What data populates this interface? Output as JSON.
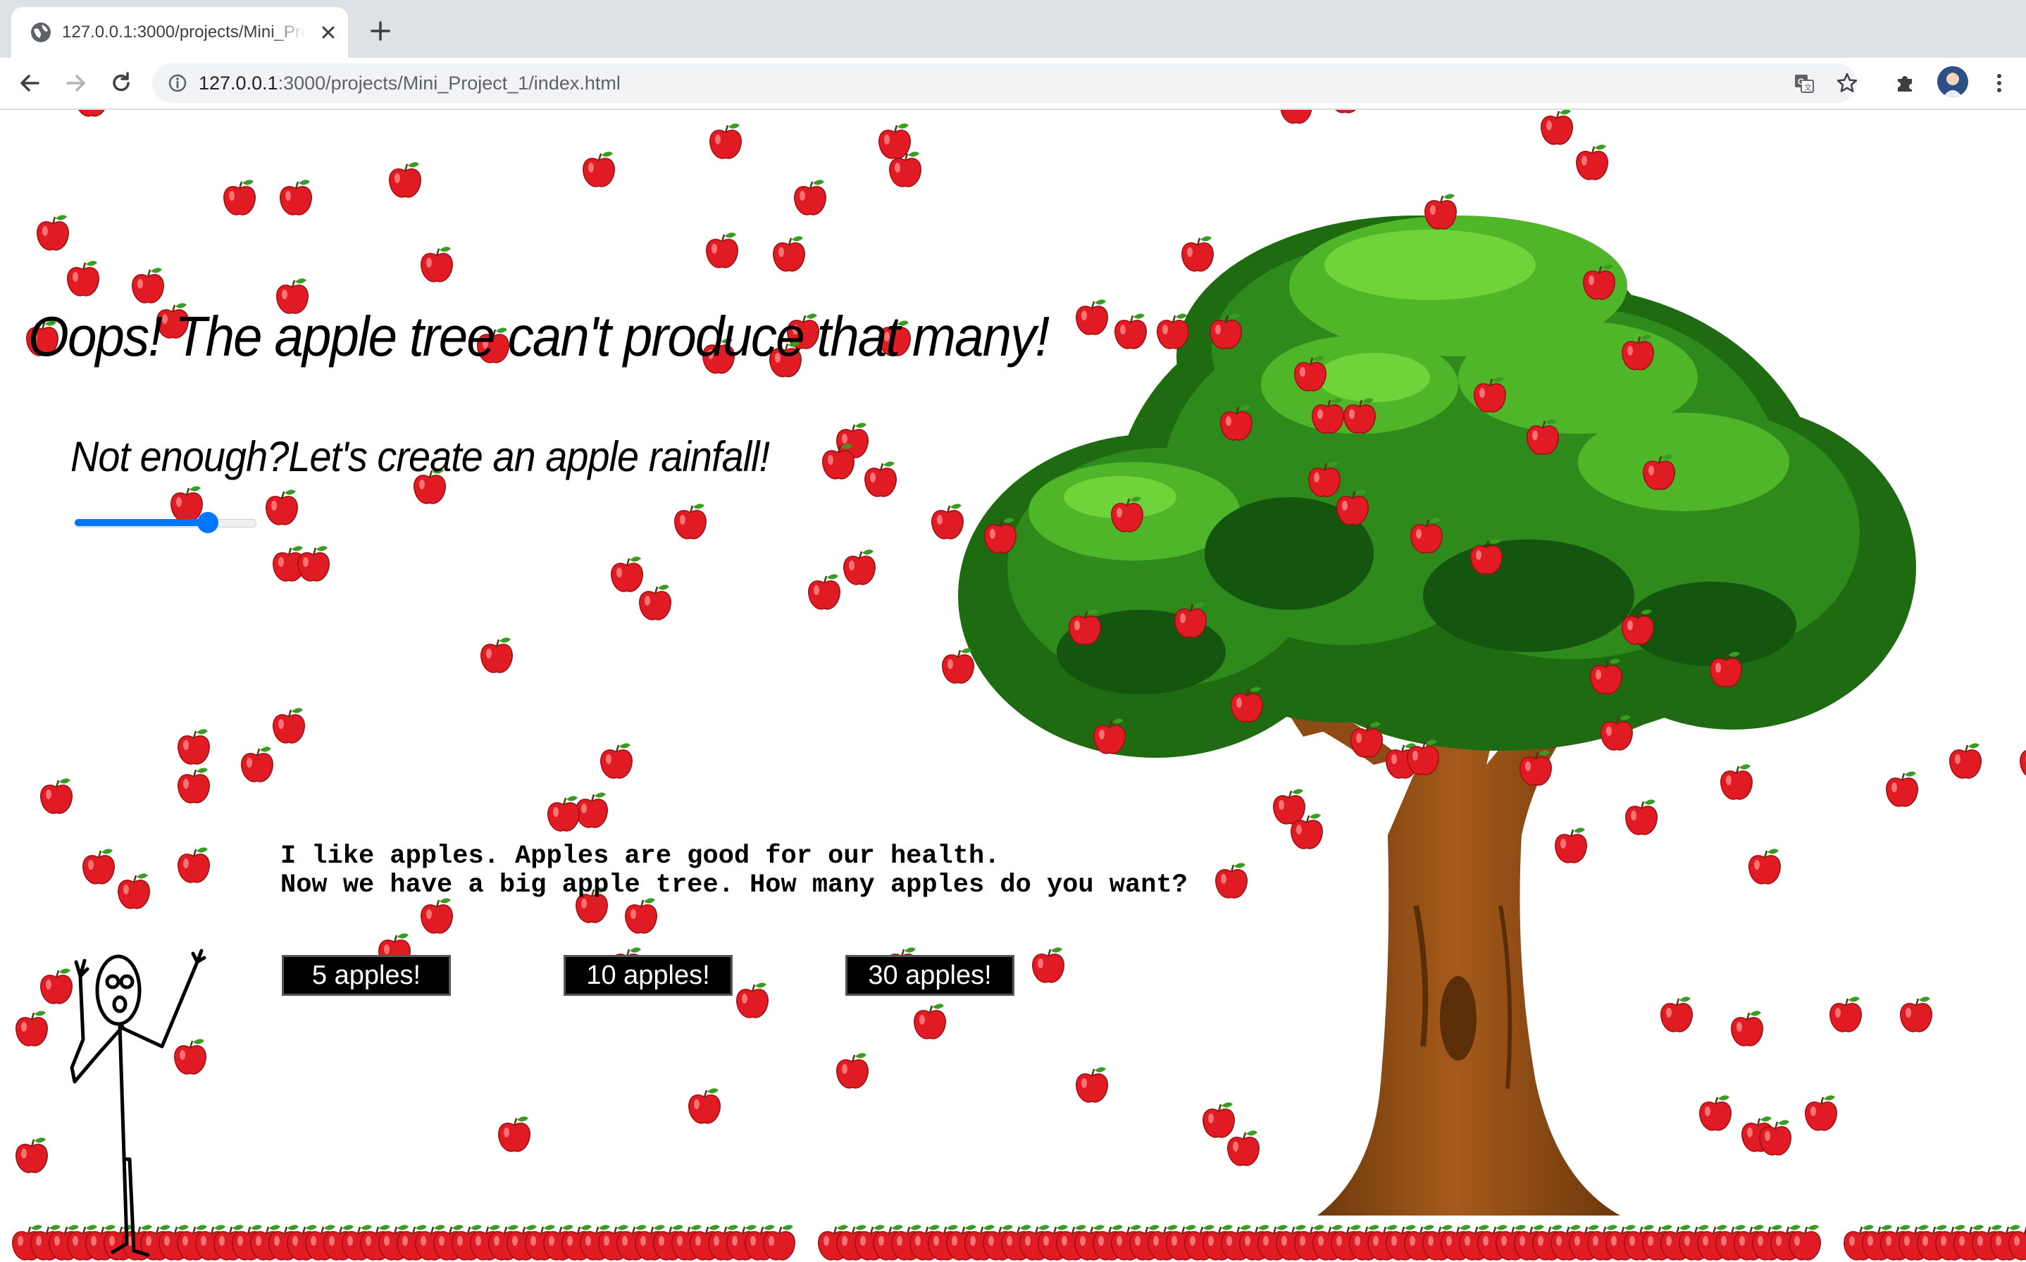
{
  "browser": {
    "tab_title": "127.0.0.1:3000/projects/Mini_Project_1/index.html",
    "url_host": "127.0.0.1",
    "url_path": ":3000/projects/Mini_Project_1/index.html"
  },
  "page": {
    "headline": "Oops! The apple tree can't produce that many!",
    "subline": "Not enough?Let's create an apple rainfall!",
    "slider_value_fraction": 0.77,
    "story_line1": "I like apples. Apples are good for our health.",
    "story_line2": "Now we have a big apple tree. How many apples do you want?",
    "buttons": [
      "5 apples!",
      "10 apples!",
      "30 apples!"
    ]
  },
  "colors": {
    "apple_red": "#e01b24",
    "leaf_green": "#3a9d23",
    "slider_blue": "#0075ff",
    "trunk_brown": "#8b4a14"
  },
  "icons": [
    "globe-icon",
    "close-icon",
    "plus-icon",
    "back-arrow-icon",
    "forward-arrow-icon",
    "reload-icon",
    "info-icon",
    "translate-icon",
    "star-icon",
    "puzzle-icon",
    "avatar",
    "kebab-menu-icon"
  ]
}
